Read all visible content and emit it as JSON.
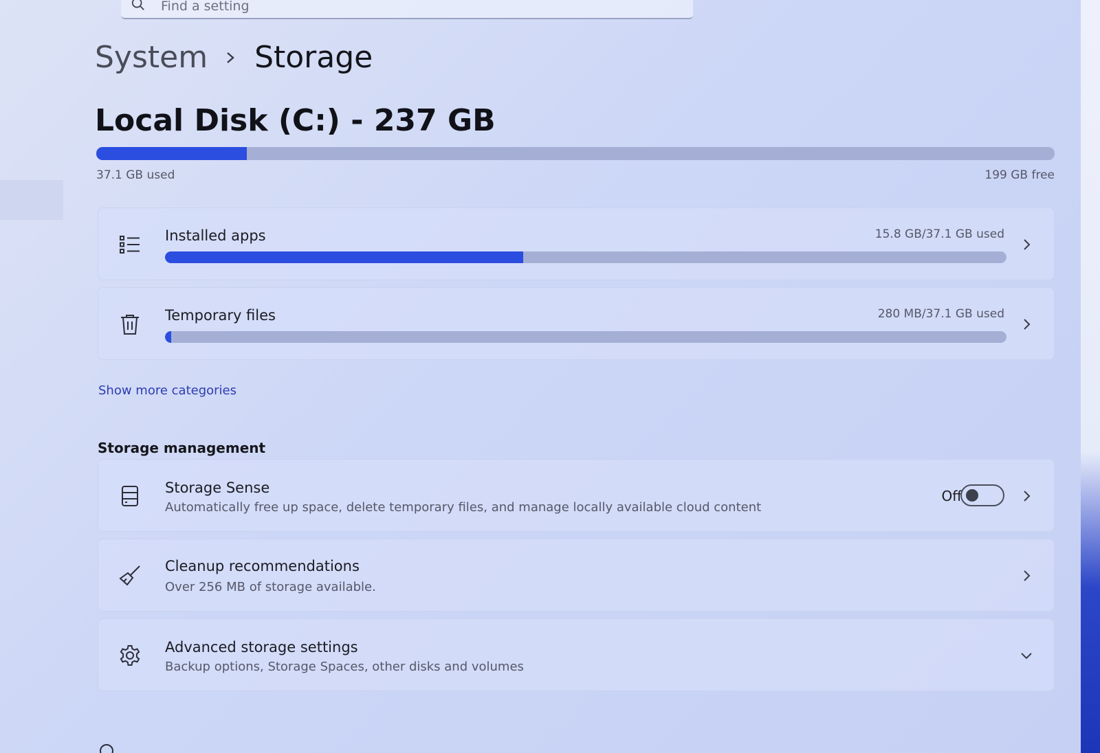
{
  "search": {
    "placeholder": "Find a setting"
  },
  "breadcrumb": {
    "parent": "System",
    "current": "Storage"
  },
  "disk": {
    "title": "Local Disk (C:) - 237 GB",
    "used_label": "37.1 GB used",
    "free_label": "199 GB free",
    "used_fraction": 0.157
  },
  "categories": [
    {
      "title": "Installed apps",
      "usage": "15.8 GB/37.1 GB used",
      "icon": "list-icon",
      "fraction": 0.426
    },
    {
      "title": "Temporary files",
      "usage": "280 MB/37.1 GB used",
      "icon": "trash-icon",
      "fraction": 0.0075
    }
  ],
  "show_more": "Show more categories",
  "management": {
    "heading": "Storage management",
    "storage_sense": {
      "title": "Storage Sense",
      "subtitle": "Automatically free up space, delete temporary files, and manage locally available cloud content",
      "toggle_label": "Off",
      "toggle_on": false
    },
    "cleanup": {
      "title": "Cleanup recommendations",
      "subtitle": "Over 256 MB of storage available."
    },
    "advanced": {
      "title": "Advanced storage settings",
      "subtitle": "Backup options, Storage Spaces, other disks and volumes"
    }
  },
  "colors": {
    "accent": "#2b4de0",
    "track": "#a5afd5",
    "link": "#2d3cb2"
  }
}
